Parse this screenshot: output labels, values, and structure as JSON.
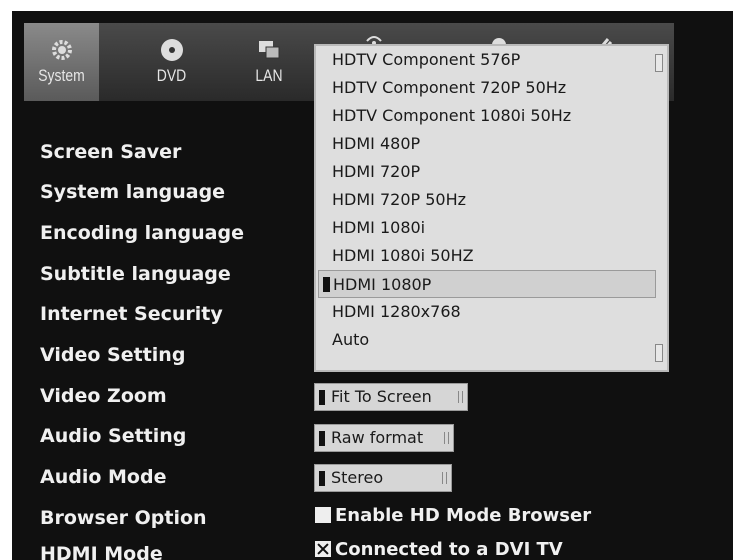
{
  "tabs": [
    {
      "label": "System",
      "icon": "gear-icon",
      "active": true
    },
    {
      "label": "DVD",
      "icon": "disc-icon"
    },
    {
      "label": "LAN",
      "icon": "network-icon"
    },
    {
      "label": "",
      "icon": "wireless-icon"
    },
    {
      "label": "",
      "icon": "globe-icon"
    },
    {
      "label": "",
      "icon": "tools-icon"
    }
  ],
  "settings": [
    "Screen Saver",
    "System language",
    "Encoding language",
    "Subtitle language",
    "Internet Security",
    "Video Setting",
    "Video Zoom",
    "Audio Setting",
    "Audio Mode",
    "Browser Option",
    "HDMI Mode"
  ],
  "dropdown": {
    "options": [
      "HDTV Component 576P",
      "HDTV Component 720P 50Hz",
      "HDTV Component 1080i 50Hz",
      "HDMI 480P",
      "HDMI 720P",
      "HDMI 720P 50Hz",
      "HDMI 1080i",
      "HDMI 1080i 50HZ",
      "HDMI 1080P",
      "HDMI 1280x768",
      "Auto"
    ],
    "selected": "HDMI 1080P"
  },
  "values": {
    "video_zoom": "Fit To Screen",
    "audio_setting": "Raw format",
    "audio_mode": "Stereo"
  },
  "browser_option": {
    "label": "Enable HD Mode Browser",
    "checked": false
  },
  "hdmi_mode": {
    "label": "Connected to a DVI TV",
    "checked": true
  },
  "colors": {
    "background": "#101010",
    "dropdown": "#dedede",
    "text": "#f0f0f0"
  }
}
